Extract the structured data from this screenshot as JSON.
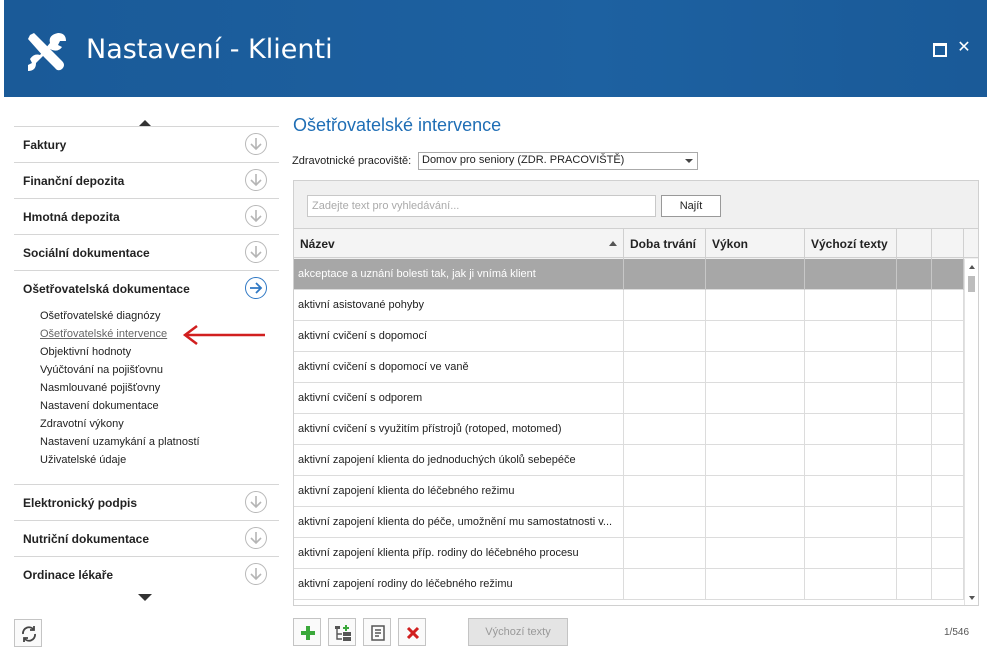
{
  "window": {
    "title": "Nastavení - Klienti",
    "accent_color": "#1b5c99",
    "max_icon": "maximize-icon",
    "close_icon": "close-icon",
    "close_glyph": "✕"
  },
  "sidebar": {
    "sections_top": [
      {
        "label": "Faktury",
        "icon": "arrow-down-circle-icon"
      },
      {
        "label": "Finanční depozita",
        "icon": "arrow-down-circle-icon"
      },
      {
        "label": "Hmotná depozita",
        "icon": "arrow-down-circle-icon"
      },
      {
        "label": "Sociální dokumentace",
        "icon": "arrow-down-circle-icon"
      },
      {
        "label": "Ošetřovatelská dokumentace",
        "icon": "arrow-right-circle-icon",
        "active": true
      }
    ],
    "subitems": [
      {
        "label": "Ošetřovatelské diagnózy"
      },
      {
        "label": "Ošetřovatelské intervence",
        "active": true
      },
      {
        "label": "Objektivní hodnoty"
      },
      {
        "label": "Vyúčtování na pojišťovnu"
      },
      {
        "label": "Nasmlouvané pojišťovny"
      },
      {
        "label": "Nastavení dokumentace"
      },
      {
        "label": "Zdravotní výkony"
      },
      {
        "label": "Nastavení uzamykání a platností"
      },
      {
        "label": "Uživatelské údaje"
      }
    ],
    "sections_bottom": [
      {
        "label": "Elektronický podpis",
        "icon": "arrow-down-circle-icon"
      },
      {
        "label": "Nutriční dokumentace",
        "icon": "arrow-down-circle-icon"
      },
      {
        "label": "Ordinace lékaře",
        "icon": "arrow-down-circle-icon"
      }
    ]
  },
  "main": {
    "title": "Ošetřovatelské intervence",
    "workstation_label": "Zdravotnické pracoviště:",
    "workstation_value": "Domov pro seniory (ZDR. PRACOVIŠTĚ)",
    "search": {
      "placeholder": "Zadejte text pro vyhledávání...",
      "value": "",
      "button_label": "Najít"
    },
    "columns": [
      "Název",
      "Doba trvání",
      "Výkon",
      "Výchozí texty",
      "",
      ""
    ],
    "sort_column": "Název",
    "rows": [
      "akceptace a uznání bolesti tak, jak ji vnímá klient",
      "aktivní asistované pohyby",
      "aktivní cvičení s dopomocí",
      "aktivní cvičení s dopomocí ve vaně",
      "aktivní cvičení s odporem",
      "aktivní cvičení s využitím přístrojů (rotoped, motomed)",
      "aktivní zapojení klienta do jednoduchých úkolů sebepéče",
      "aktivní zapojení klienta do léčebného režimu",
      "aktivní zapojení klienta do péče, umožnění mu samostatnosti v...",
      "aktivní zapojení klienta příp. rodiny do léčebného procesu",
      "aktivní zapojení rodiny do léčebného režimu"
    ],
    "selected_row": 0,
    "toolbar": {
      "add_icon": "add-icon",
      "add_sub_icon": "add-subitem-icon",
      "edit_icon": "edit-icon",
      "delete_icon": "delete-icon",
      "default_texts_label": "Výchozí texty"
    },
    "pager": "1/546"
  },
  "refresh_icon": "refresh-icon"
}
